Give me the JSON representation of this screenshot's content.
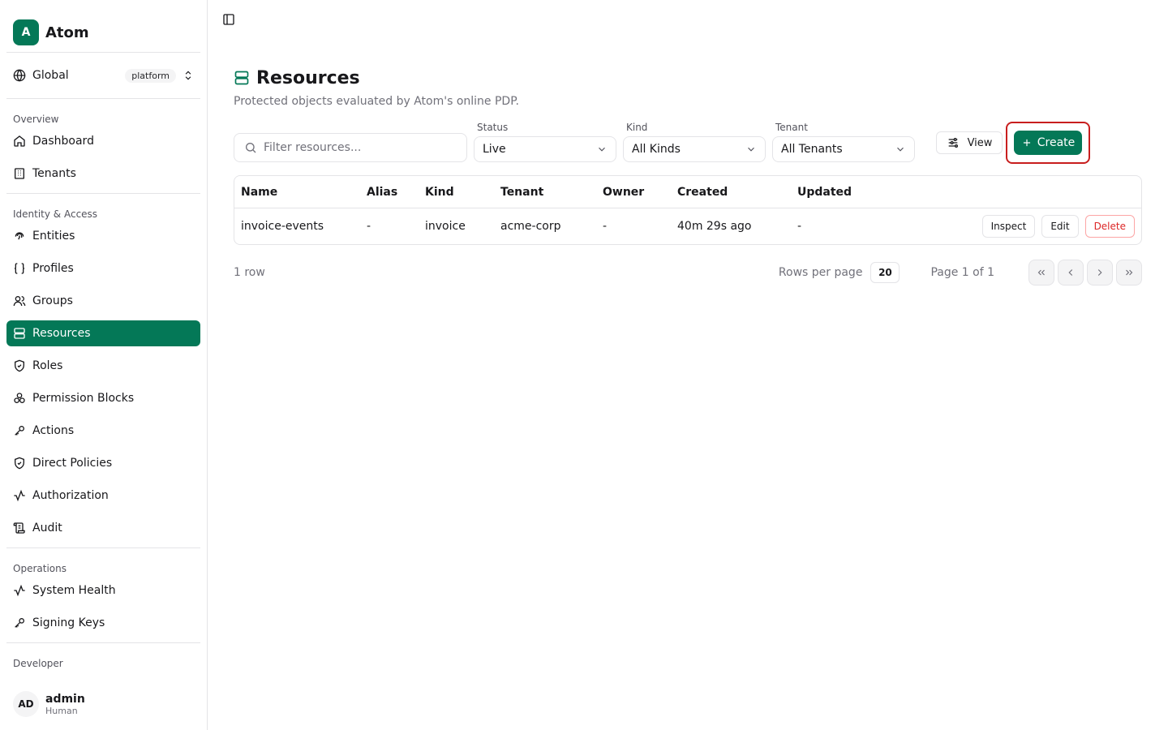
{
  "brand": {
    "logo_letter": "A",
    "name": "Atom"
  },
  "scope": {
    "label": "Global",
    "badge": "platform"
  },
  "sidebar": {
    "sections": [
      {
        "title": "Overview",
        "items": [
          {
            "label": "Dashboard",
            "icon": "home-icon"
          },
          {
            "label": "Tenants",
            "icon": "building-icon"
          }
        ]
      },
      {
        "title": "Identity & Access",
        "items": [
          {
            "label": "Entities",
            "icon": "fingerprint-icon"
          },
          {
            "label": "Profiles",
            "icon": "braces-icon"
          },
          {
            "label": "Groups",
            "icon": "users-icon"
          },
          {
            "label": "Resources",
            "icon": "database-icon",
            "active": true
          },
          {
            "label": "Roles",
            "icon": "shield-icon"
          },
          {
            "label": "Permission Blocks",
            "icon": "blocks-icon"
          },
          {
            "label": "Actions",
            "icon": "key-icon"
          },
          {
            "label": "Direct Policies",
            "icon": "shield-check-icon"
          },
          {
            "label": "Authorization",
            "icon": "activity-icon"
          },
          {
            "label": "Audit",
            "icon": "scroll-icon"
          }
        ]
      },
      {
        "title": "Operations",
        "items": [
          {
            "label": "System Health",
            "icon": "activity-icon"
          },
          {
            "label": "Signing Keys",
            "icon": "key-icon"
          }
        ]
      },
      {
        "title": "Developer",
        "items": []
      }
    ]
  },
  "user": {
    "initials": "AD",
    "name": "admin",
    "role": "Human"
  },
  "page": {
    "title": "Resources",
    "subtitle": "Protected objects evaluated by Atom's online PDP."
  },
  "filters": {
    "search_placeholder": "Filter resources...",
    "status_label": "Status",
    "status_value": "Live",
    "kind_label": "Kind",
    "kind_value": "All Kinds",
    "tenant_label": "Tenant",
    "tenant_value": "All Tenants",
    "view_label": "View",
    "create_label": "Create"
  },
  "table": {
    "columns": [
      "Name",
      "Alias",
      "Kind",
      "Tenant",
      "Owner",
      "Created",
      "Updated"
    ],
    "rows": [
      {
        "name": "invoice-events",
        "alias": "-",
        "kind": "invoice",
        "tenant": "acme-corp",
        "owner": "-",
        "created": "40m 29s ago",
        "updated": "-"
      }
    ],
    "actions": {
      "inspect": "Inspect",
      "edit": "Edit",
      "delete": "Delete"
    }
  },
  "pagination": {
    "rows_count": "1 row",
    "rows_per_page_label": "Rows per page",
    "rows_per_page": "20",
    "page_info": "Page 1 of 1"
  },
  "colors": {
    "accent": "#047857",
    "danger": "#dc2626",
    "highlight": "#c81e1e"
  }
}
